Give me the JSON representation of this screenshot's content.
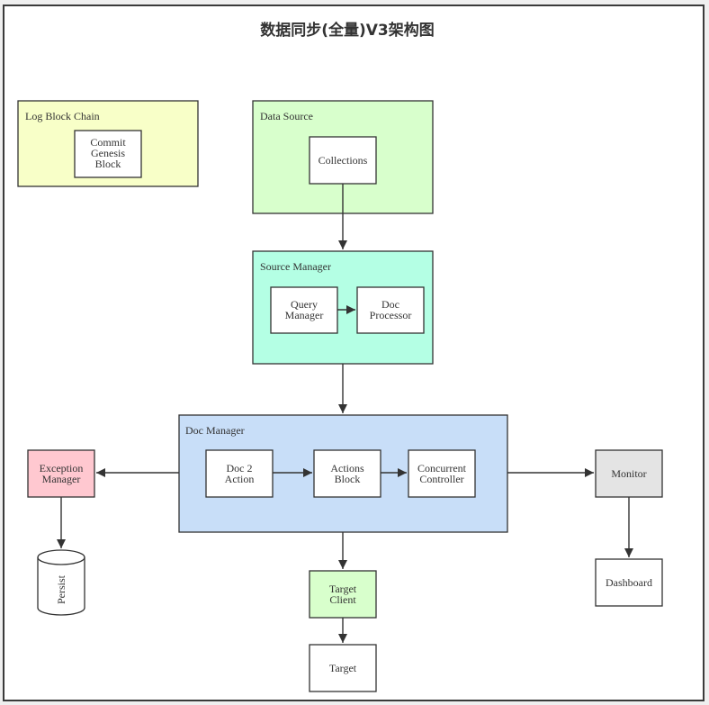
{
  "title": "数据同步(全量)V3架构图",
  "colors": {
    "log_block_chain": "#f8ffc8",
    "data_source": "#d8ffcc",
    "source_manager": "#b4ffe4",
    "doc_manager": "#c8def8",
    "exception_manager": "#ffc8d0",
    "monitor": "#e4e4e4",
    "target_client": "#d8ffcc",
    "plain_node": "#ffffff",
    "stroke": "#333333"
  },
  "clusters": {
    "log_block_chain": {
      "label": "Log Block Chain"
    },
    "data_source": {
      "label": "Data Source"
    },
    "source_manager": {
      "label": "Source Manager"
    },
    "doc_manager": {
      "label": "Doc Manager"
    }
  },
  "nodes": {
    "commit_genesis_block": {
      "lines": [
        "Commit",
        "Genesis",
        "Block"
      ]
    },
    "collections": {
      "lines": [
        "Collections"
      ]
    },
    "query_manager": {
      "lines": [
        "Query",
        "Manager"
      ]
    },
    "doc_processor": {
      "lines": [
        "Doc",
        "Processor"
      ]
    },
    "doc2action": {
      "lines": [
        "Doc 2",
        "Action"
      ]
    },
    "actions_block": {
      "lines": [
        "Actions",
        "Block"
      ]
    },
    "concurrent_controller": {
      "lines": [
        "Concurrent",
        "Controller"
      ]
    },
    "exception_manager": {
      "lines": [
        "Exception",
        "Manager"
      ]
    },
    "persist": {
      "lines": [
        "Persist"
      ]
    },
    "monitor": {
      "lines": [
        "Monitor"
      ]
    },
    "dashboard": {
      "lines": [
        "Dashboard"
      ]
    },
    "target_client": {
      "lines": [
        "Target",
        "Client"
      ]
    },
    "target": {
      "lines": [
        "Target"
      ]
    }
  },
  "edges": [
    {
      "from": "Collections",
      "to": "Source Manager"
    },
    {
      "from": "Query Manager",
      "to": "Doc Processor"
    },
    {
      "from": "Source Manager",
      "to": "Doc Manager"
    },
    {
      "from": "Doc 2 Action",
      "to": "Actions Block"
    },
    {
      "from": "Actions Block",
      "to": "Concurrent Controller"
    },
    {
      "from": "Doc Manager",
      "to": "Exception Manager"
    },
    {
      "from": "Exception Manager",
      "to": "Persist"
    },
    {
      "from": "Doc Manager",
      "to": "Monitor"
    },
    {
      "from": "Monitor",
      "to": "Dashboard"
    },
    {
      "from": "Doc Manager",
      "to": "Target Client"
    },
    {
      "from": "Target Client",
      "to": "Target"
    }
  ]
}
